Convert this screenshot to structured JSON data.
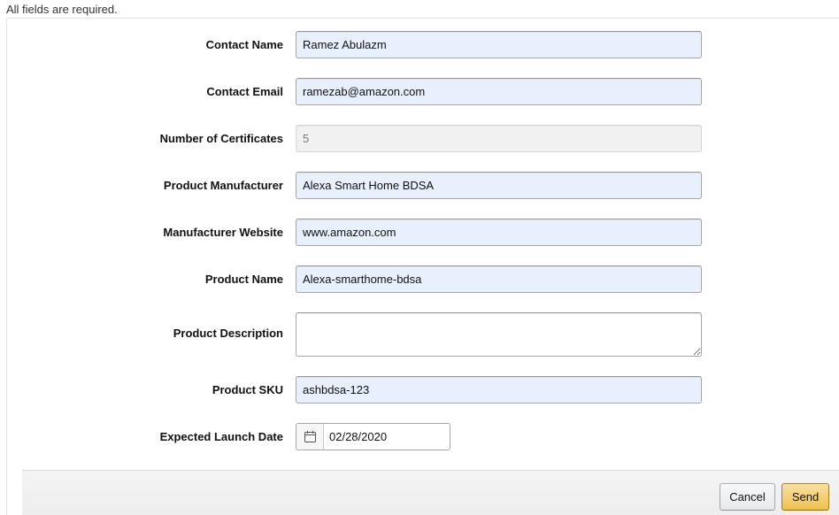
{
  "form": {
    "required_note": "All fields are required.",
    "contact_name": {
      "label": "Contact Name",
      "value": "Ramez Abulazm"
    },
    "contact_email": {
      "label": "Contact Email",
      "value": "ramezab@amazon.com"
    },
    "num_certificates": {
      "label": "Number of Certificates",
      "value": "5"
    },
    "product_manufacturer": {
      "label": "Product Manufacturer",
      "value": "Alexa Smart Home BDSA"
    },
    "manufacturer_website": {
      "label": "Manufacturer Website",
      "value": "www.amazon.com"
    },
    "product_name": {
      "label": "Product Name",
      "value": "Alexa-smarthome-bdsa"
    },
    "product_description": {
      "label": "Product Description",
      "value": ""
    },
    "product_sku": {
      "label": "Product SKU",
      "value": "ashbdsa-123"
    },
    "launch_date": {
      "label": "Expected Launch Date",
      "value": "02/28/2020",
      "icon": "calendar-icon"
    }
  },
  "footer": {
    "cancel_label": "Cancel",
    "send_label": "Send"
  },
  "colors": {
    "autofill_bg": "#e8f0fe",
    "primary_button": "#f0c14b"
  }
}
